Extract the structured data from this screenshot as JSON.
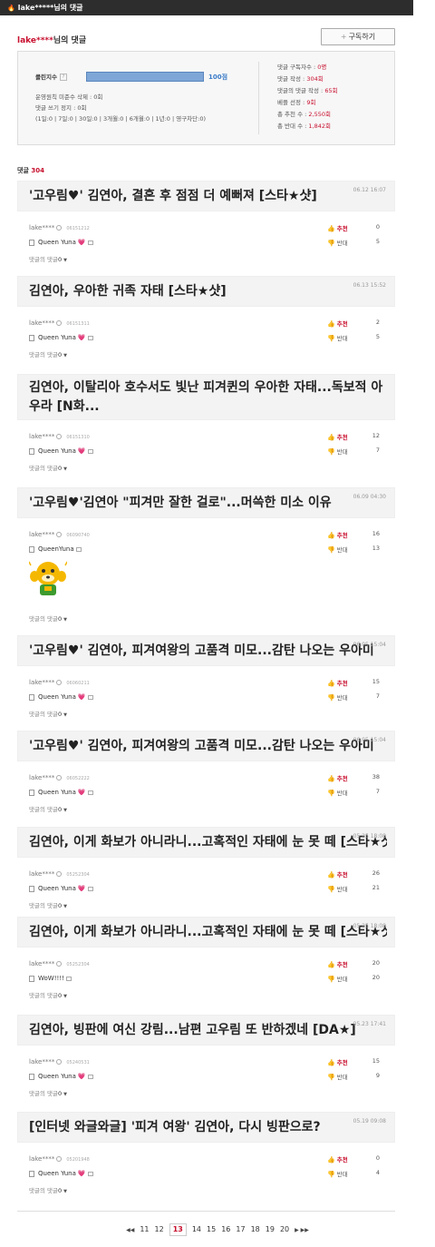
{
  "topbar": {
    "title": "lake*****님의 댓글"
  },
  "user": {
    "nick": "lake****",
    "suffix": "님의 댓글",
    "subscribe_label": "구독하기"
  },
  "clean": {
    "label": "클린지수",
    "help": "?",
    "score_text": "100점",
    "score_fraction": 1.0,
    "lines": [
      "운영원칙 미준수 삭제 : 0회",
      "댓글 쓰기 정지 : 0회",
      "(1일:0 | 7일:0 | 30일:0 | 3개월:0 | 6개월:0 | 1년:0 | 영구차단:0)"
    ]
  },
  "stats": [
    {
      "label": "댓글 구독자수 : ",
      "value": "0명"
    },
    {
      "label": "댓글 작성 : ",
      "value": "304회"
    },
    {
      "label": "댓글의 댓글 작성 : ",
      "value": "65회"
    },
    {
      "label": "베플 선정 : ",
      "value": "9회"
    },
    {
      "label": "총 추천 수 : ",
      "value": "2,550회"
    },
    {
      "label": "총 반대 수 : ",
      "value": "1,842회"
    }
  ],
  "count": {
    "label": "댓글",
    "value": "304"
  },
  "labels": {
    "up": "추천",
    "down": "반대",
    "replies": "댓글의 댓글",
    "up_icon": "👍",
    "down_icon": "👎"
  },
  "comments": [
    {
      "title": "'고우림♥' 김연아, 결혼 후 점점 더 예뻐져 [스타★샷]",
      "date": "06.12 16:07",
      "user": "lake****",
      "mid": "06151212",
      "text": "Queen Yuna",
      "heart": true,
      "up": "0",
      "down": "5",
      "replies": "0"
    },
    {
      "title": "김연아, 우아한 귀족 자태 [스타★샷]",
      "date": "06.13 15:52",
      "user": "lake****",
      "mid": "06151311",
      "text": "Queen Yuna",
      "heart": true,
      "up": "2",
      "down": "5",
      "replies": "0"
    },
    {
      "title": "김연아, 이탈리아 호수서도 빛난 피겨퀸의 우아한 자태...독보적 아우라 [N화...",
      "date": "",
      "user": "lake****",
      "mid": "06151310",
      "text": "Queen Yuna",
      "heart": true,
      "up": "12",
      "down": "7",
      "replies": "0"
    },
    {
      "title": "'고우림♥'김연아 \"피겨만 잘한 걸로\"...머쓱한 미소 이유",
      "date": "06.09 04:30",
      "user": "lake****",
      "mid": "06090740",
      "text": "QueenYuna",
      "heart": false,
      "up": "16",
      "down": "13",
      "replies": "0"
    },
    {
      "title": "'고우림♥' 김연아, 피겨여왕의 고품격 미모...감탄 나오는 우아미",
      "date": "06.05 15:04",
      "user": "lake****",
      "mid": "06060211",
      "text": "Queen Yuna",
      "heart": true,
      "up": "15",
      "down": "7",
      "replies": "0"
    },
    {
      "title": "'고우림♥' 김연아, 피겨여왕의 고품격 미모...감탄 나오는 우아미",
      "date": "06.05 15:04",
      "user": "lake****",
      "mid": "06052222",
      "text": "Queen Yuna",
      "heart": true,
      "up": "38",
      "down": "7",
      "replies": "0"
    },
    {
      "title": "김연아, 이게 화보가 아니라니...고혹적인 자태에 눈 못 떼 [스타★샷]",
      "date": "05.25 18:08",
      "user": "lake****",
      "mid": "05252304",
      "text": "Queen Yuna",
      "heart": true,
      "up": "26",
      "down": "21",
      "replies": "0"
    },
    {
      "title": "김연아, 이게 화보가 아니라니...고혹적인 자태에 눈 못 떼 [스타★샷]",
      "date": "05.25 18:08",
      "user": "lake****",
      "mid": "05252304",
      "text": "WoW!!!!",
      "heart": false,
      "up": "20",
      "down": "20",
      "replies": "0"
    },
    {
      "title": "김연아, 빙판에 여신 강림...남편 고우림 또 반하겠네 [DA★]",
      "date": "05.23 17:41",
      "user": "lake****",
      "mid": "05240531",
      "text": "Queen Yuna",
      "heart": true,
      "up": "15",
      "down": "9",
      "replies": "0"
    },
    {
      "title": "[인터넷 와글와글] '피겨 여왕' 김연아, 다시 빙판으로?",
      "date": "05.19 09:08",
      "user": "lake****",
      "mid": "05201948",
      "text": "Queen Yuna",
      "heart": true,
      "up": "0",
      "down": "4",
      "replies": "0"
    }
  ],
  "pager": {
    "first": "◀◀",
    "pages": [
      "11",
      "12",
      "13",
      "14",
      "15",
      "16",
      "17",
      "18",
      "19",
      "20"
    ],
    "current": "13",
    "next": "▶ ▶▶"
  }
}
